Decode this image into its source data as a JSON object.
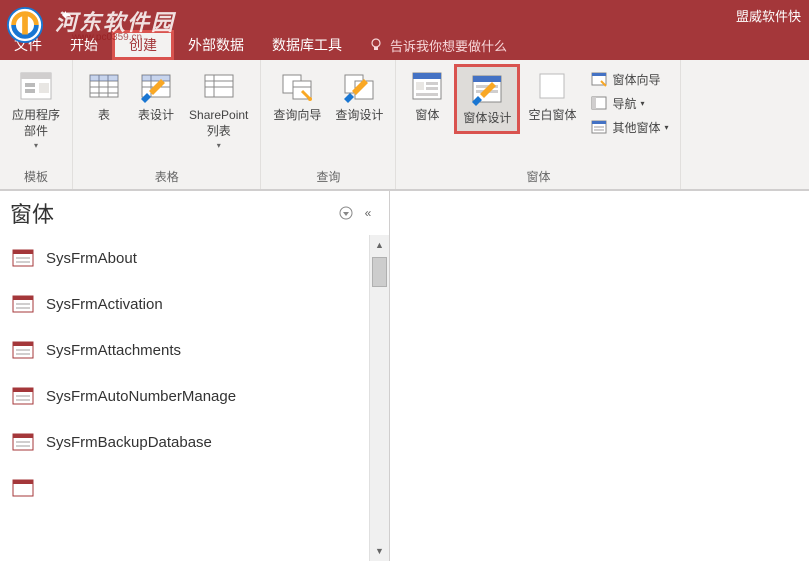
{
  "titlebar": {
    "title_partial": "盟威软件快",
    "watermark": "河东软件园",
    "watermark_url": "www.pc0359.cn"
  },
  "menu": {
    "tabs": [
      "文件",
      "开始",
      "创建",
      "外部数据",
      "数据库工具"
    ],
    "active_index": 2,
    "tell_me": "告诉我你想要做什么"
  },
  "ribbon": {
    "groups": [
      {
        "label": "模板",
        "items": [
          {
            "label": "应用程序\n部件",
            "icon": "app-parts",
            "has_dropdown": true
          }
        ]
      },
      {
        "label": "表格",
        "items": [
          {
            "label": "表",
            "icon": "table"
          },
          {
            "label": "表设计",
            "icon": "table-design"
          },
          {
            "label": "SharePoint\n列表",
            "icon": "sharepoint",
            "has_dropdown": true
          }
        ]
      },
      {
        "label": "查询",
        "items": [
          {
            "label": "查询向导",
            "icon": "query-wizard"
          },
          {
            "label": "查询设计",
            "icon": "query-design"
          }
        ]
      },
      {
        "label": "窗体",
        "items": [
          {
            "label": "窗体",
            "icon": "form"
          },
          {
            "label": "窗体设计",
            "icon": "form-design",
            "highlighted": true
          },
          {
            "label": "空白窗体",
            "icon": "blank-form"
          }
        ],
        "side_items": [
          {
            "label": "窗体向导",
            "icon": "form-wizard"
          },
          {
            "label": "导航",
            "icon": "navigation",
            "has_dropdown": true
          },
          {
            "label": "其他窗体",
            "icon": "more-forms",
            "has_dropdown": true
          }
        ]
      }
    ]
  },
  "nav": {
    "title": "窗体",
    "items": [
      "SysFrmAbout",
      "SysFrmActivation",
      "SysFrmAttachments",
      "SysFrmAutoNumberManage",
      "SysFrmBackupDatabase"
    ]
  }
}
